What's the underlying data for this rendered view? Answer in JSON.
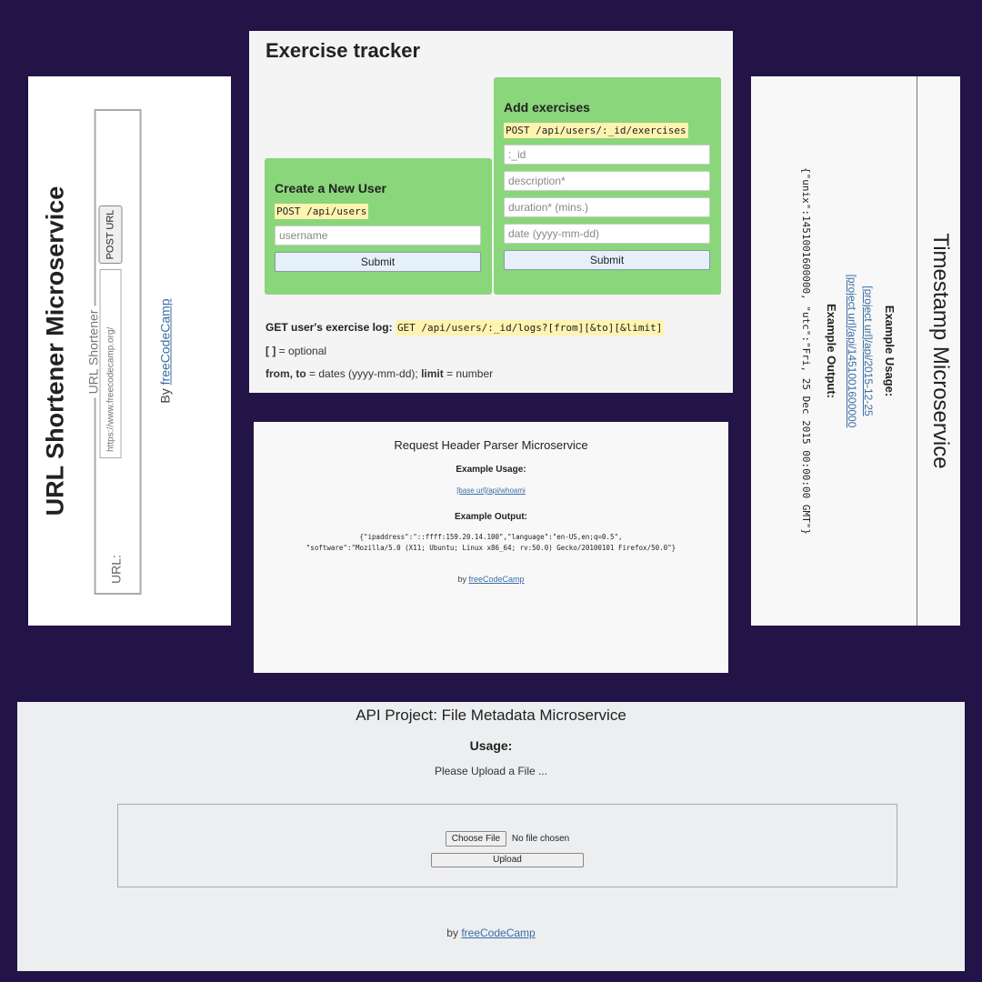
{
  "url_shortener": {
    "title": "URL Shortener Microservice",
    "legend": "URL Shortener",
    "url_label": "URL:",
    "url_placeholder": "https://www.freecodecamp.org/",
    "submit_label": "POST URL",
    "by_prefix": "By",
    "by_link": "freeCodeCamp"
  },
  "exercise_tracker": {
    "title": "Exercise tracker",
    "new_user": {
      "heading": "Create a New User",
      "endpoint": "POST /api/users",
      "username_placeholder": "username",
      "submit_label": "Submit"
    },
    "add_exercises": {
      "heading": "Add exercises",
      "endpoint": "POST /api/users/:_id/exercises",
      "id_placeholder": ":_id",
      "description_placeholder": "description*",
      "duration_placeholder": "duration* (mins.)",
      "date_placeholder": "date (yyyy-mm-dd)",
      "submit_label": "Submit"
    },
    "log": {
      "label": "GET user's exercise log:",
      "endpoint": "GET /api/users/:_id/logs?[from][&to][&limit]"
    },
    "optional_brackets": "[ ]",
    "optional_text": "= optional",
    "dates_keys": "from, to",
    "dates_text": "= dates (yyyy-mm-dd);",
    "limit_key": "limit",
    "limit_text": "= number"
  },
  "timestamp": {
    "title": "Timestamp Microservice",
    "example_usage": "Example Usage:",
    "link1": "[project url]/api/2015-12-25",
    "link2": "[project url]/api/1451001600000",
    "example_output": "Example Output:",
    "output_json": "{\"unix\":1451001600000, \"utc\":\"Fri, 25 Dec 2015 00:00:00 GMT\"}"
  },
  "header_parser": {
    "title": "Request Header Parser Microservice",
    "example_usage": "Example Usage:",
    "link": "[base url]/api/whoami",
    "example_output": "Example Output:",
    "output_line1": "{\"ipaddress\":\"::ffff:159.20.14.100\",\"language\":\"en-US,en;q=0.5\",",
    "output_line2": "\"software\":\"Mozilla/5.0 (X11; Ubuntu; Linux x86_64; rv:50.0) Gecko/20100101 Firefox/50.0\"}",
    "by_prefix": "by",
    "by_link": "freeCodeCamp"
  },
  "file_metadata": {
    "title": "API Project: File Metadata Microservice",
    "usage": "Usage:",
    "please": "Please Upload a File ...",
    "choose_file": "Choose File",
    "no_file": "No file chosen",
    "upload": "Upload",
    "by_prefix": "by",
    "by_link": "freeCodeCamp"
  },
  "colors": {
    "background": "#221446",
    "card_green": "#8ad67a",
    "code_highlight": "#fff3b0",
    "link": "#3b6ea5"
  }
}
